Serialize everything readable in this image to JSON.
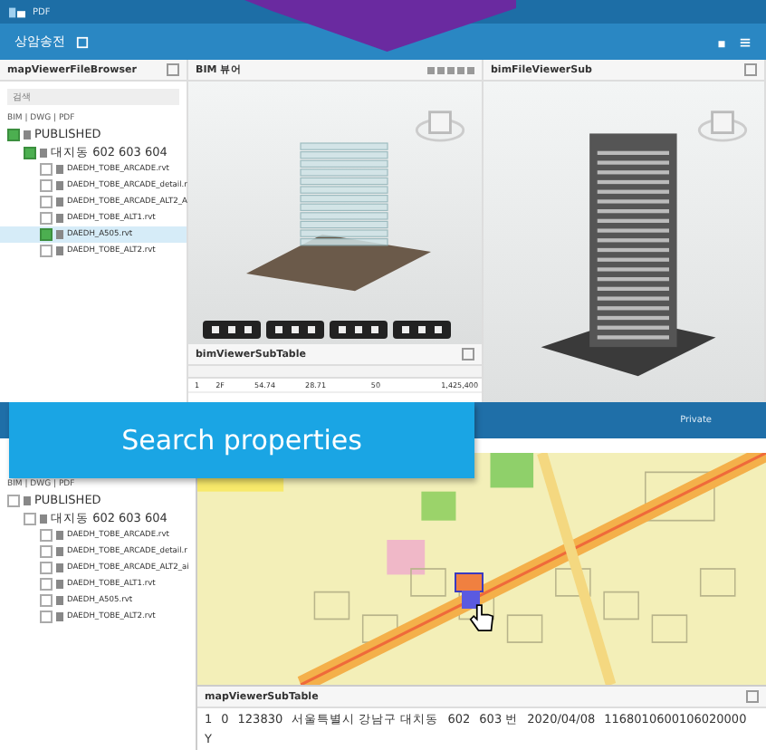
{
  "top_window": {
    "app_links": [
      "PDF"
    ],
    "project": "상암송전",
    "file_browser": {
      "title": "mapViewerFileBrowser",
      "search": {
        "placeholder": "검색"
      },
      "filter": "BIM | DWG | PDF",
      "tree": [
        {
          "label": "PUBLISHED",
          "checked": true,
          "selected": false,
          "children": [
            {
              "label": "대지동 602 603 604",
              "checked": true,
              "selected": false,
              "children": [
                {
                  "label": "DAEDH_TOBE_ARCADE.rvt",
                  "checked": false,
                  "selected": false
                },
                {
                  "label": "DAEDH_TOBE_ARCADE_detail.r",
                  "checked": false,
                  "selected": false
                },
                {
                  "label": "DAEDH_TOBE_ARCADE_ALT2_A",
                  "checked": false,
                  "selected": false
                },
                {
                  "label": "DAEDH_TOBE_ALT1.rvt",
                  "checked": false,
                  "selected": false
                },
                {
                  "label": "DAEDH_A505.rvt",
                  "checked": true,
                  "selected": true
                },
                {
                  "label": "DAEDH_TOBE_ALT2.rvt",
                  "checked": false,
                  "selected": false
                }
              ]
            }
          ]
        }
      ]
    },
    "bim_viewer": {
      "title": "BIM 뷰어"
    },
    "sub_viewer": {
      "title": "bimFileViewerSub"
    },
    "sub_table": {
      "title": "bimViewerSubTable",
      "rows": [
        [
          "1",
          "2F",
          "54.74",
          "28.71",
          "50",
          "1,425,400"
        ]
      ]
    }
  },
  "banner": "Search properties",
  "bottom_window": {
    "header_link": "Private",
    "file_browser": {
      "filter": "BIM | DWG | PDF",
      "tree": [
        {
          "label": "PUBLISHED",
          "checked": false,
          "selected": false,
          "children": [
            {
              "label": "대지동 602 603 604",
              "checked": false,
              "selected": false,
              "children": [
                {
                  "label": "DAEDH_TOBE_ARCADE.rvt",
                  "checked": false,
                  "selected": false
                },
                {
                  "label": "DAEDH_TOBE_ARCADE_detail.r",
                  "checked": false,
                  "selected": false
                },
                {
                  "label": "DAEDH_TOBE_ARCADE_ALT2_ai",
                  "checked": false,
                  "selected": false
                },
                {
                  "label": "DAEDH_TOBE_ALT1.rvt",
                  "checked": false,
                  "selected": false
                },
                {
                  "label": "DAEDH_A505.rvt",
                  "checked": false,
                  "selected": false
                },
                {
                  "label": "DAEDH_TOBE_ALT2.rvt",
                  "checked": false,
                  "selected": false
                }
              ]
            }
          ]
        }
      ]
    },
    "map_table": {
      "title": "mapViewerSubTable",
      "rows": [
        [
          "1",
          "0",
          "123830",
          "서울특별시 강남구 대치동",
          "602",
          "603 번",
          "2020/04/08",
          "1168010600106020000",
          "Y"
        ]
      ]
    }
  }
}
